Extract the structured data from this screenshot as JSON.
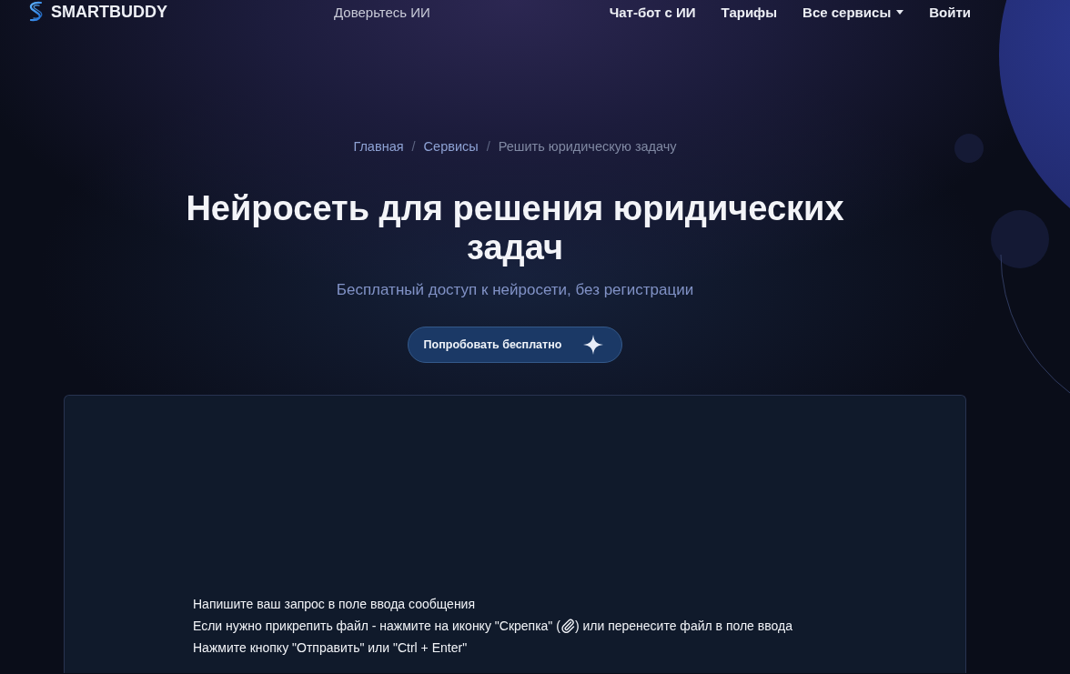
{
  "header": {
    "logo": "SMARTBUDDY",
    "tagline": "Доверьтесь ИИ",
    "nav": [
      {
        "label": "Чат-бот с ИИ",
        "kind": "link"
      },
      {
        "label": "Тарифы",
        "kind": "link"
      },
      {
        "label": "Все сервисы",
        "kind": "dropdown"
      },
      {
        "label": "Войти",
        "kind": "link"
      }
    ]
  },
  "breadcrumb": [
    {
      "label": "Главная",
      "kind": "link"
    },
    {
      "label": "/",
      "kind": "separator"
    },
    {
      "label": "Сервисы",
      "kind": "link"
    },
    {
      "label": "/",
      "kind": "separator"
    },
    {
      "label": "Решить юридическую задачу",
      "kind": "current"
    }
  ],
  "hero": {
    "title": "Нейросеть для решения юридических задач",
    "subtitle": "Бесплатный доступ к нейросети, без регистрации",
    "button": "Попробовать бесплатно"
  },
  "chat": {
    "instructions": [
      {
        "kind": "text",
        "text": "Напишите ваш запрос в поле ввода сообщения"
      },
      {
        "kind": "with_icon",
        "before": "Если нужно прикрепить файл - нажмите на иконку \"Скрепка\" (",
        "after": ") или перенесите файл в поле ввода"
      },
      {
        "kind": "text",
        "text": "Нажмите кнопку \"Отправить\" или \"Ctrl + Enter\""
      }
    ]
  }
}
